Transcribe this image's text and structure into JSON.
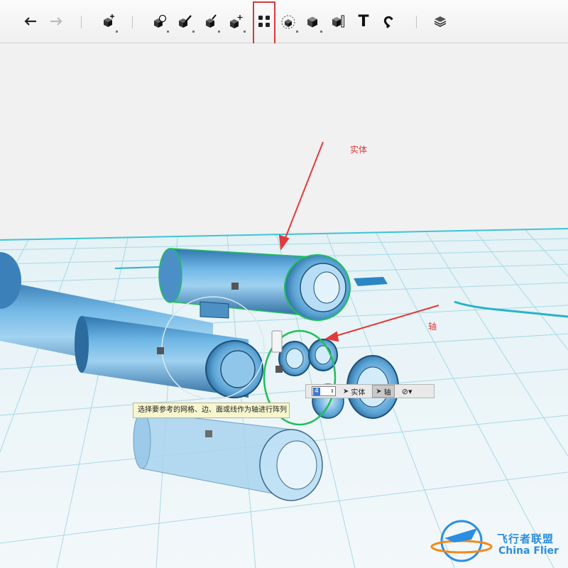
{
  "toolbar": {
    "buttons": [
      {
        "name": "undo",
        "icon": "undo-arrow-icon"
      },
      {
        "name": "redo",
        "icon": "redo-arrow-icon"
      },
      {
        "name": "add-primitive",
        "icon": "add-box-icon"
      },
      {
        "name": "combine",
        "icon": "combine-icon"
      },
      {
        "name": "modify",
        "icon": "modify-brush-icon"
      },
      {
        "name": "construct",
        "icon": "construct-cube-icon"
      },
      {
        "name": "transform",
        "icon": "transform-cube-icon"
      },
      {
        "name": "pattern",
        "icon": "pattern-grid-icon",
        "selected": true
      },
      {
        "name": "snap",
        "icon": "snap-icon"
      },
      {
        "name": "group",
        "icon": "group-cube-icon"
      },
      {
        "name": "measure",
        "icon": "measure-cube-icon"
      },
      {
        "name": "text",
        "icon": "text-t-icon",
        "label": "T"
      },
      {
        "name": "magnet",
        "icon": "magnet-icon"
      },
      {
        "name": "layers",
        "icon": "layers-icon"
      }
    ]
  },
  "annotations": {
    "solid_label": "实体",
    "axis_label": "轴",
    "color": "#e23a3a"
  },
  "tooltip": {
    "text": "选择要参考的网格、边、面或线作为轴进行阵列"
  },
  "pattern_bar": {
    "count_value": "4",
    "solid_button": "实体",
    "axis_button": "轴",
    "axis_active": true
  },
  "watermark": {
    "cn": "飞行者联盟",
    "en": "China Flier"
  },
  "colors": {
    "accent_blue": "#4a9fd6",
    "grid_cyan": "#3cc4d8",
    "selection_green": "#1fbf5a",
    "highlight_red": "#d43a3a"
  }
}
